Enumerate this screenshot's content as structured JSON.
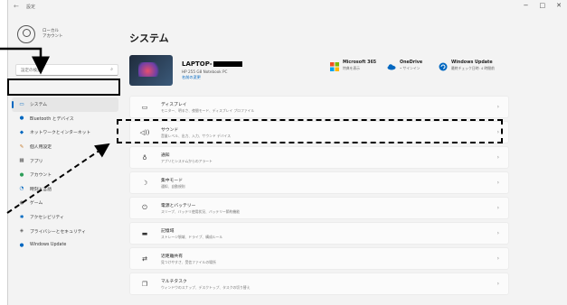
{
  "window": {
    "back_glyph": "←",
    "app_title": "設定",
    "controls": [
      "−",
      "□",
      "✕"
    ]
  },
  "profile": {
    "name_line1": "ローカル",
    "name_line2": "アカウント"
  },
  "search": {
    "placeholder": "設定の検索",
    "icon": "search-icon"
  },
  "sidebar": {
    "items": [
      {
        "label": "システム",
        "icon": "system-icon",
        "glyph": "▭",
        "color": "#0067c0",
        "active": true
      },
      {
        "label": "Bluetooth とデバイス",
        "icon": "bluetooth-icon",
        "glyph": "●",
        "color": "#0067c0"
      },
      {
        "label": "ネットワークとインターネット",
        "icon": "network-icon",
        "glyph": "◆",
        "color": "#0067c0"
      },
      {
        "label": "個人用設定",
        "icon": "personalization-icon",
        "glyph": "✎",
        "color": "#c47a2c"
      },
      {
        "label": "アプリ",
        "icon": "apps-icon",
        "glyph": "▦",
        "color": "#555555"
      },
      {
        "label": "アカウント",
        "icon": "accounts-icon",
        "glyph": "●",
        "color": "#2e9e5a"
      },
      {
        "label": "時刻と言語",
        "icon": "time-language-icon",
        "glyph": "◔",
        "color": "#0067c0"
      },
      {
        "label": "ゲーム",
        "icon": "gaming-icon",
        "glyph": "◉",
        "color": "#555555"
      },
      {
        "label": "アクセシビリティ",
        "icon": "accessibility-icon",
        "glyph": "✱",
        "color": "#0067c0"
      },
      {
        "label": "プライバシーとセキュリティ",
        "icon": "privacy-icon",
        "glyph": "◈",
        "color": "#666666"
      },
      {
        "label": "Windows Update",
        "icon": "windows-update-icon",
        "glyph": "●",
        "color": "#0067c0"
      }
    ]
  },
  "main": {
    "heading": "システム",
    "pc": {
      "name": "LAPTOP-",
      "model": "HP 255 G8 Notebook PC",
      "rename": "名前の変更"
    },
    "status": [
      {
        "title": "Microsoft 365",
        "sub": "特典を表示",
        "icon": "microsoft365-icon"
      },
      {
        "title": "OneDrive",
        "sub": "• サインイン",
        "icon": "onedrive-icon"
      },
      {
        "title": "Windows Update",
        "sub": "最終チェック日時: 4 時間前",
        "icon": "windows-update-status-icon"
      }
    ],
    "cards": [
      {
        "title": "ディスプレイ",
        "desc": "モニター、明るさ、夜間モード、ディスプレイ プロファイル",
        "icon": "display-icon",
        "glyph": "▭"
      },
      {
        "title": "サウンド",
        "desc": "音量レベル、出力、入力、サウンド デバイス",
        "icon": "sound-icon",
        "glyph": "◁))"
      },
      {
        "title": "通知",
        "desc": "アプリとシステムからのアラート",
        "icon": "notifications-icon",
        "glyph": "♁"
      },
      {
        "title": "集中モード",
        "desc": "通知、自動規則",
        "icon": "focus-icon",
        "glyph": "☽"
      },
      {
        "title": "電源とバッテリー",
        "desc": "スリープ、バッテリ使用状況、バッテリー節約機能",
        "icon": "power-icon",
        "glyph": "⏻"
      },
      {
        "title": "記憶域",
        "desc": "ストレージ領域、ドライブ、構成ルール",
        "icon": "storage-icon",
        "glyph": "▬"
      },
      {
        "title": "近距離共有",
        "desc": "見つけやすさ、受信ファイルの場所",
        "icon": "nearby-sharing-icon",
        "glyph": "⇄"
      },
      {
        "title": "マルチタスク",
        "desc": "ウィンドウのスナップ、デスクトップ、タスクの切り替え",
        "icon": "multitasking-icon",
        "glyph": "❐"
      }
    ]
  },
  "chevron": "›",
  "colors": {
    "accent": "#0067c0",
    "annotation": "#000000"
  }
}
